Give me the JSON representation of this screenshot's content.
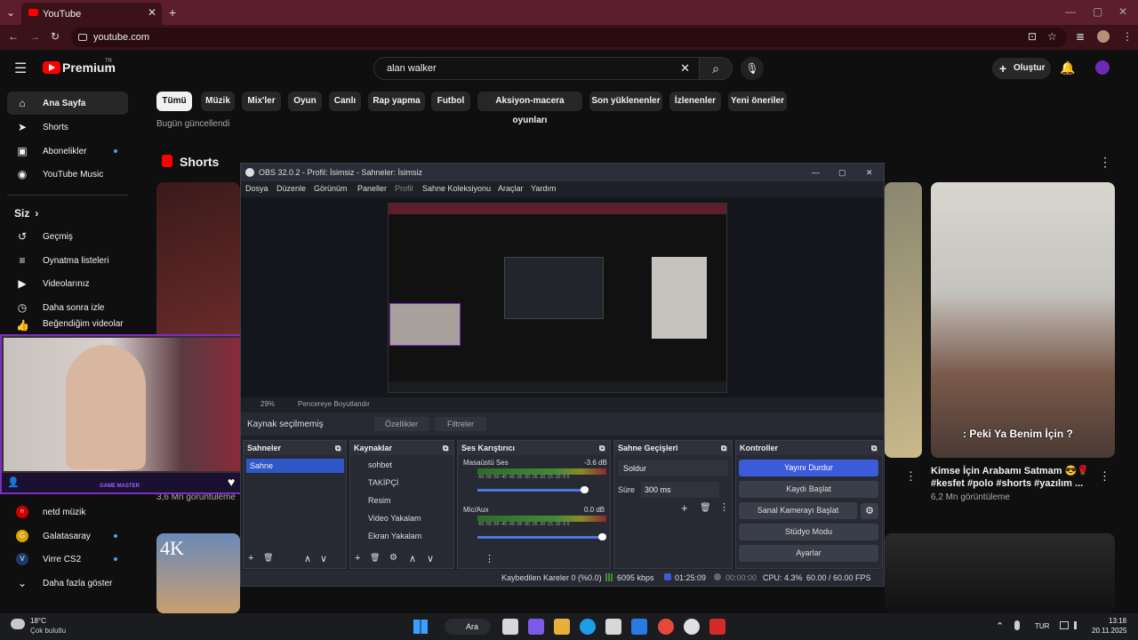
{
  "browser": {
    "tab_title": "YouTube",
    "new_tab": "+",
    "url": "youtube.com",
    "close": "✕",
    "win_min": "—",
    "win_max": "▢",
    "win_close": "✕",
    "back": "←",
    "fwd": "→",
    "reload": "↻",
    "more": "⋮",
    "tab_menu": "⌄",
    "icons": {
      "install": "⊡",
      "bookmark": "☆",
      "media": "≣"
    }
  },
  "youtube": {
    "menu_icon": "☰",
    "logo": "Premium",
    "logo_sup": "TR",
    "search_query": "alan walker",
    "clear": "✕",
    "search_icon": "⌕",
    "mic": "🎙",
    "create_label": "Oluştur",
    "create_plus": "+",
    "bell": "🔔",
    "sidebar": {
      "items": [
        {
          "label": "Ana Sayfa",
          "icon": "⌂"
        },
        {
          "label": "Shorts",
          "icon": "➤"
        },
        {
          "label": "Abonelikler",
          "icon": "▣"
        },
        {
          "label": "YouTube Music",
          "icon": "◉"
        }
      ],
      "you_heading": "Siz",
      "you_chev": "›",
      "you_items": [
        {
          "label": "Geçmiş",
          "icon": "↺"
        },
        {
          "label": "Oynatma listeleri",
          "icon": "≡"
        },
        {
          "label": "Videolarınız",
          "icon": "▶"
        },
        {
          "label": "Daha sonra izle",
          "icon": "◷"
        },
        {
          "label": "Beğendiğim videolar",
          "icon": "👍"
        }
      ],
      "subs": [
        {
          "label": "netd müzik",
          "icon": "n"
        },
        {
          "label": "Galatasaray",
          "icon": "G"
        },
        {
          "label": "Virre CS2",
          "icon": "V"
        }
      ],
      "more_label": "Daha fazla göster",
      "more_icon": "⌄"
    },
    "chips": [
      "Tümü",
      "Müzik",
      "Mix'ler",
      "Oyun",
      "Canlı",
      "Rap yapma",
      "Futbol",
      "Aksiyon-macera oyunları",
      "Son yüklenenler",
      "İzlenenler",
      "Yeni öneriler"
    ],
    "updated_today": "Bugün güncellendi",
    "shorts_title": "Shorts",
    "shorts_more": "⋮",
    "short_left_views": "3,6 Mn görüntüleme",
    "short_right_title": "Kimse İçin Arabamı Satmam 😎🌹 #kesfet #polo #shorts #yazılım ...",
    "short_right_views": "6,2 Mn görüntüleme",
    "short_right_caption": ": Peki Ya Benim İçin ?",
    "short_menu": "⋮",
    "thumb_4k": "4K"
  },
  "webcam": {
    "label": "GAME MASTER",
    "person": "👤",
    "heart": "♥"
  },
  "obs": {
    "title": "OBS 32.0.2 - Profil: İsimsiz - Sahneler: İsimsiz",
    "win_min": "—",
    "win_max": "▢",
    "win_close": "✕",
    "menu": [
      "Dosya",
      "Düzenle",
      "Görünüm",
      "Paneller",
      "Profil",
      "Sahne Koleksiyonu",
      "Araçlar",
      "Yardım"
    ],
    "zoom": "29%",
    "zoom_label": "Pencereye Boyutlandır",
    "no_source": "Kaynak seçilmemiş",
    "properties": "Özellikler",
    "filters": "Filtreler",
    "scenes_title": "Sahneler",
    "scenes": [
      "Sahne"
    ],
    "sources_title": "Kaynaklar",
    "sources": [
      "sohbet",
      "TAKİPÇİ",
      "Resim",
      "Video Yakalam",
      "Ekran Yakalam"
    ],
    "mixer_title": "Ses Karıştırıcı",
    "mixer": [
      {
        "name": "Masaüstü Ses",
        "db": "-3.6 dB"
      },
      {
        "name": "Mic/Aux",
        "db": "0.0 dB"
      }
    ],
    "mixer_scale": "-60 -55 -50 -45 -40 -35 -30 -25 -20 -15 -10 -5 0",
    "transitions_title": "Sahne Geçişleri",
    "transition": "Soldur",
    "duration_label": "Süre",
    "duration": "300 ms",
    "controls_title": "Kontroller",
    "controls": [
      "Yayını Durdur",
      "Kaydı Başlat",
      "Sanal Kamerayı Başlat",
      "Stüdyo Modu",
      "Ayarlar"
    ],
    "gear": "⚙",
    "dock_icon": "⧉",
    "add": "+",
    "remove": "🗑",
    "up": "∧",
    "down": "∨",
    "menu_dots": "⋮",
    "status": {
      "dropped": "Kaybedilen Kareler 0 (%0.0)",
      "bitrate": "6095 kbps",
      "stream_time": "01:25:09",
      "rec_time": "00:00:00",
      "cpu": "CPU: 4.3%",
      "fps": "60.00 / 60.00 FPS"
    }
  },
  "taskbar": {
    "weather_temp": "18°C",
    "weather_desc": "Çok bulutlu",
    "search": "Ara",
    "lang": "TUR",
    "time": "13:18",
    "date": "20.11.2025",
    "tray_up": "⌃"
  },
  "colors": {
    "accent": "#3b5bdb",
    "yt_red": "#ff0000",
    "tab_bg": "#5b1e2a"
  }
}
